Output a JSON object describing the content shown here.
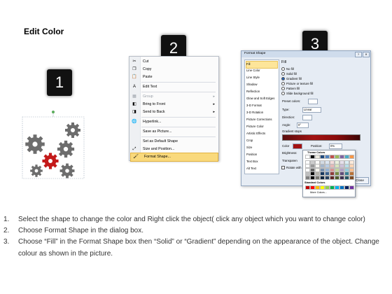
{
  "title": "Edit Color",
  "steps": {
    "one": "1",
    "two": "2",
    "three": "3"
  },
  "context_menu": {
    "items": [
      {
        "label": "Cut",
        "icon": "cut-icon"
      },
      {
        "label": "Copy",
        "icon": "copy-icon"
      },
      {
        "label": "Paste",
        "icon": "paste-icon"
      },
      {
        "label": "Edit Text",
        "icon": "edit-text-icon"
      },
      {
        "label": "Group",
        "icon": "group-icon",
        "disabled": true
      },
      {
        "label": "Bring to Front",
        "icon": "bring-front-icon",
        "submenu": true
      },
      {
        "label": "Send to Back",
        "icon": "send-back-icon",
        "submenu": true
      },
      {
        "label": "Hyperlink...",
        "icon": "hyperlink-icon"
      },
      {
        "label": "Save as Picture...",
        "icon": ""
      },
      {
        "label": "Set as Default Shape",
        "icon": ""
      },
      {
        "label": "Size and Position...",
        "icon": "size-position-icon"
      },
      {
        "label": "Format Shape...",
        "icon": "format-shape-icon",
        "highlighted": true
      }
    ]
  },
  "format_shape": {
    "window_title": "Format Shape",
    "categories": [
      "Fill",
      "Line Color",
      "Line Style",
      "Shadow",
      "Reflection",
      "Glow and Soft Edges",
      "3-D Format",
      "3-D Rotation",
      "Picture Corrections",
      "Picture Color",
      "Artistic Effects",
      "Crop",
      "Size",
      "Position",
      "Text Box",
      "Alt Text"
    ],
    "selected_category": "Fill",
    "fill_heading": "Fill",
    "fill_options": [
      "No fill",
      "Solid fill",
      "Gradient fill",
      "Picture or texture fill",
      "Pattern fill",
      "Slide background fill"
    ],
    "selected_fill": "Gradient fill",
    "preset_colors_label": "Preset colors:",
    "type_label": "Type:",
    "type_value": "Linear",
    "direction_label": "Direction:",
    "angle_label": "Angle:",
    "angle_value": "0°",
    "gradient_stops_label": "Gradient stops",
    "color_label": "Color",
    "position_label": "Position:",
    "position_value": "0%",
    "brightness_label": "Brightness:",
    "transparency_label": "Transparen",
    "rotate_label": "Rotate with shape",
    "close_button": "Close"
  },
  "palette": {
    "theme_heading": "Theme Colors",
    "standard_heading": "Standard Colors",
    "more_colors": "More Colors...",
    "theme_colors": [
      "#ffffff",
      "#000000",
      "#eeece1",
      "#1f497d",
      "#4f81bd",
      "#c0504d",
      "#9bbb59",
      "#8064a2",
      "#4bacc6",
      "#f79646"
    ],
    "standard_colors": [
      "#c00000",
      "#ff0000",
      "#ffc000",
      "#ffff00",
      "#92d050",
      "#00b050",
      "#00b0f0",
      "#0070c0",
      "#002060",
      "#7030a0"
    ]
  },
  "instructions": [
    {
      "num": "1.",
      "text": "Select the shape to change the color and Right click the object( click any object which you want to change color)"
    },
    {
      "num": "2.",
      "text": "Choose Format Shape in the dialog box."
    },
    {
      "num": "3.",
      "text": "Choose “Fill” in the Format Shape box then “Solid” or “Gradient” depending on the appearance of the object. Change colour as shown in the picture."
    }
  ]
}
